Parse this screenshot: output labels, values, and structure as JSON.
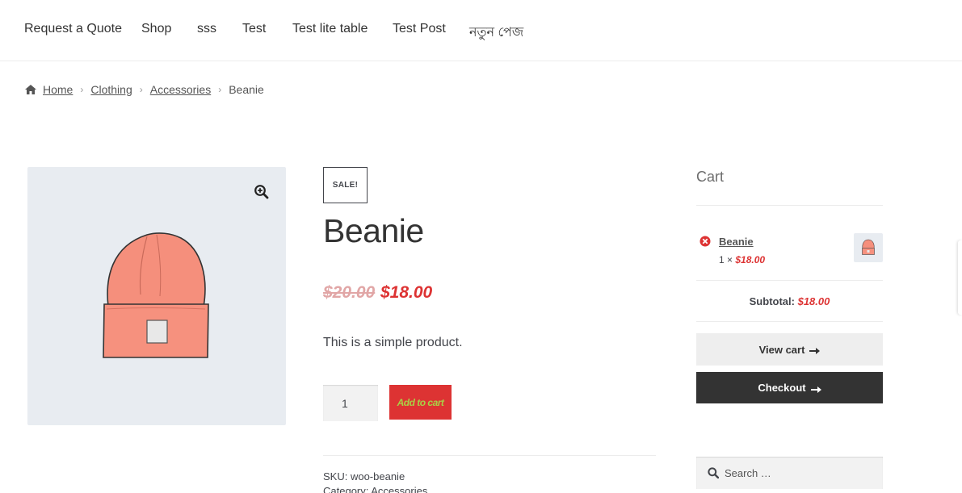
{
  "nav": {
    "items": [
      "Request a Quote",
      "Shop",
      "sss",
      "Test",
      "Test lite table",
      "Test Post",
      "নতুন পেজ"
    ]
  },
  "breadcrumb": {
    "home": "Home",
    "clothing": "Clothing",
    "accessories": "Accessories",
    "current": "Beanie"
  },
  "product": {
    "sale_badge": "SALE!",
    "title": "Beanie",
    "regular_price": "$20.00",
    "sale_price": "$18.00",
    "short_description": "This is a simple product.",
    "quantity": "1",
    "add_to_cart_label": "Add to cart",
    "sku_line": "SKU: woo-beanie",
    "category_line_prefix": "Category: ",
    "category": "Accessories"
  },
  "cart": {
    "title": "Cart",
    "item_name": "Beanie",
    "item_qty_prefix": "1 × ",
    "item_amount": "$18.00",
    "subtotal_label": "Subtotal:",
    "subtotal_amount": "$18.00",
    "view_cart_label": "View cart",
    "checkout_label": "Checkout"
  },
  "search": {
    "placeholder": "Search …"
  },
  "colors": {
    "accent": "#dd3333",
    "button_text": "#a9d046",
    "dark_button": "#333333",
    "image_bg": "#e8ecf1",
    "beanie": "#f58f7c"
  },
  "icons": {
    "home": "home-icon",
    "zoom": "zoom-in-icon",
    "remove": "remove-circle-icon",
    "arrow": "arrow-right-icon",
    "search": "search-icon"
  }
}
